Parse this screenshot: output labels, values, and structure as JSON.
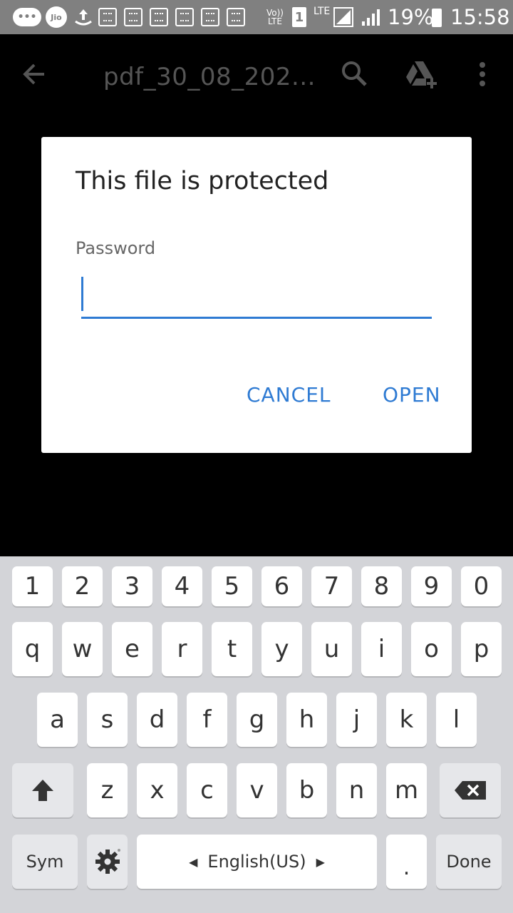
{
  "status_bar": {
    "jio_label": "Jio",
    "volte_label": "Vo))\nLTE",
    "lte_label": "LTE",
    "sim_label": "1",
    "battery_percent": "19%",
    "time": "15:58"
  },
  "app_bar": {
    "title": "pdf_30_08_202..."
  },
  "dialog": {
    "title": "This file is protected",
    "password_label": "Password",
    "password_value": "",
    "cancel_label": "CANCEL",
    "open_label": "OPEN"
  },
  "keyboard": {
    "row_numbers": [
      "1",
      "2",
      "3",
      "4",
      "5",
      "6",
      "7",
      "8",
      "9",
      "0"
    ],
    "row_top": [
      "q",
      "w",
      "e",
      "r",
      "t",
      "y",
      "u",
      "i",
      "o",
      "p"
    ],
    "row_middle": [
      "a",
      "s",
      "d",
      "f",
      "g",
      "h",
      "j",
      "k",
      "l"
    ],
    "row_bottom": [
      "z",
      "x",
      "c",
      "v",
      "b",
      "n",
      "m"
    ],
    "sym_label": "Sym",
    "space_label": "English(US)",
    "period_label": ".",
    "done_label": "Done"
  },
  "colors": {
    "accent": "#2f7bd3",
    "status_bar": "#808080",
    "keyboard_bg": "#d3d4d8"
  }
}
